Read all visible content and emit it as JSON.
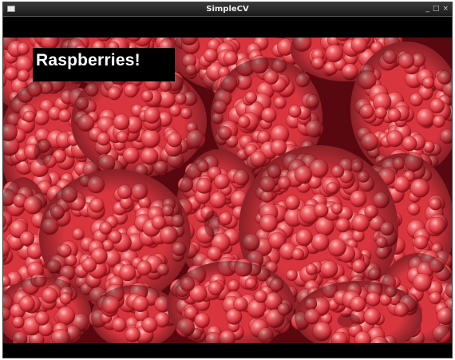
{
  "window": {
    "title": "SimpleCV",
    "controls": {
      "minimize": "_",
      "maximize": "□",
      "close": "×"
    }
  },
  "canvas": {
    "overlay_text": "Raspberries!",
    "colors": {
      "berry_base": "#d8353f",
      "berry_light": "#ff8f8c",
      "berry_dark": "#8e0f18",
      "shadow": "#3a0509",
      "label_bg": "#000000",
      "label_fg": "#ffffff"
    }
  }
}
